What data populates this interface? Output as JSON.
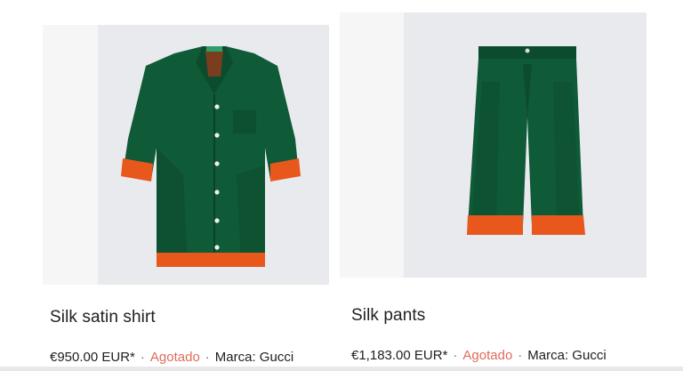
{
  "products": [
    {
      "title": "Silk satin shirt",
      "price": "€950.00 EUR*",
      "status": "Agotado",
      "brand": "Marca: Gucci",
      "image_icon": "shirt-image"
    },
    {
      "title": "Silk pants",
      "price": "€1,183.00 EUR*",
      "status": "Agotado",
      "brand": "Marca: Gucci",
      "image_icon": "pants-image"
    }
  ],
  "separator": "·",
  "colors": {
    "garment_green": "#0f5a37",
    "trim_orange": "#e8581c",
    "status_red": "#e06b5c",
    "text": "#202124",
    "image_bg": "#e9eaee"
  }
}
